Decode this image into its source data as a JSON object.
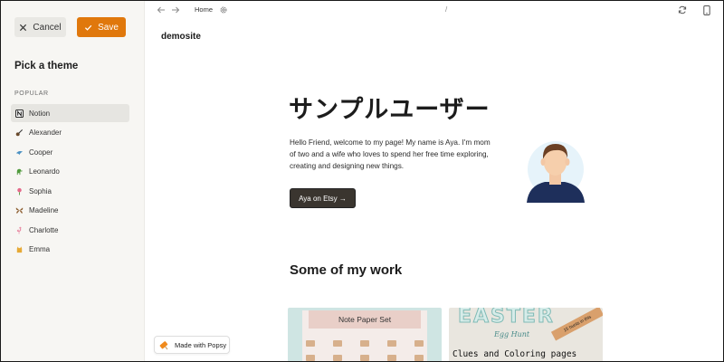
{
  "sidebar": {
    "cancel_label": "Cancel",
    "save_label": "Save",
    "title": "Pick a theme",
    "section_label": "POPULAR",
    "themes": [
      {
        "label": "Notion",
        "icon": "notion-icon"
      },
      {
        "label": "Alexander",
        "icon": "guitar-icon"
      },
      {
        "label": "Cooper",
        "icon": "dolphin-icon"
      },
      {
        "label": "Leonardo",
        "icon": "dinosaur-icon"
      },
      {
        "label": "Sophia",
        "icon": "flower-icon"
      },
      {
        "label": "Madeline",
        "icon": "butterfly-icon"
      },
      {
        "label": "Charlotte",
        "icon": "flamingo-icon"
      },
      {
        "label": "Emma",
        "icon": "cat-icon"
      }
    ],
    "selected_theme": "Notion",
    "badge_label": "Made with Popsy"
  },
  "topbar": {
    "home_label": "Home",
    "path": "/"
  },
  "page": {
    "site_name": "demosite",
    "hero_title": "サンプルユーザー",
    "hero_text": "Hello Friend, welcome to my page! My name is Aya. I'm mom of two and a wife who loves to spend her free time exploring, creating and designing new things.",
    "cta_label": "Aya on Etsy →",
    "work_title": "Some of my work",
    "cards": [
      {
        "title": "Note Paper Set"
      },
      {
        "title": "EASTER",
        "subtitle": "Egg Hunt",
        "tag": "15 hunts in this",
        "caption": "Clues and Coloring pages"
      }
    ]
  },
  "colors": {
    "accent": "#e0780c",
    "cta_bg": "#3a352f",
    "sidebar_bg": "#f7f6f3"
  }
}
